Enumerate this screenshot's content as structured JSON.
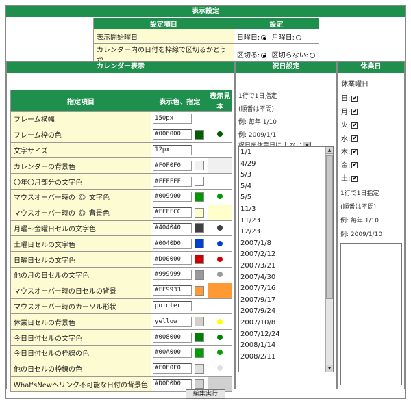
{
  "title": "表示設定",
  "top": {
    "col_item": "設定項目",
    "col_setting": "設定",
    "start_day_label": "表示開始曜日",
    "start_day_opt1": "日曜日:",
    "start_day_opt2": "月曜日:",
    "border_label": "カレンダー内の日付を枠線で区切るかどうか",
    "border_opt1": "区切る:",
    "border_opt2": "区切らない:"
  },
  "calendar": {
    "title": "カレンダー表示",
    "col_item": "指定項目",
    "col_value": "表示色、指定",
    "col_sample": "表示見本",
    "rows": [
      {
        "label": "フレーム横幅",
        "value": "150px",
        "swatch": "",
        "dot": ""
      },
      {
        "label": "フレーム枠の色",
        "value": "#006000",
        "swatch": "#006000",
        "dot": "#006000"
      },
      {
        "label": "文字サイズ",
        "value": "12px",
        "swatch": "",
        "dot": ""
      },
      {
        "label": "カレンダーの背景色",
        "value": "#F0F0F0",
        "swatch": "#F0F0F0",
        "dot": "",
        "sample_bg": "#F0F0F0"
      },
      {
        "label": "〇年〇月部分の文字色",
        "value": "#FFFFFF",
        "swatch": "#FFFFFF",
        "dot": ""
      },
      {
        "label": "マウスオーバー時の《》文字色",
        "value": "#009900",
        "swatch": "#009900",
        "dot": "#009900"
      },
      {
        "label": "マウスオーバー時の《》背景色",
        "value": "#FFFFCC",
        "swatch": "#FFFFCC",
        "dot": "",
        "sample_bg": "#FFFFCC"
      },
      {
        "label": "月曜～金曜日セルの文字色",
        "value": "#404040",
        "swatch": "#404040",
        "dot": "#404040"
      },
      {
        "label": "土曜日セルの文字色",
        "value": "#0040D0",
        "swatch": "#0040D0",
        "dot": "#0040D0"
      },
      {
        "label": "日曜日セルの文字色",
        "value": "#D00000",
        "swatch": "#D00000",
        "dot": "#D00000"
      },
      {
        "label": "他の月の日セルの文字色",
        "value": "#999999",
        "swatch": "#999999",
        "dot": "#999999"
      },
      {
        "label": "マウスオーバー時の日セルの背景",
        "value": "#FF9933",
        "swatch": "#FF9933",
        "dot": "",
        "sample_bg": "#FF9933"
      },
      {
        "label": "マウスオーバー時のカーソル形状",
        "value": "pointer",
        "swatch": "",
        "dot": ""
      },
      {
        "label": "休業日セルの背景色",
        "value": "yellow",
        "swatch": "#D4D0C8",
        "dot": "#FFFF00"
      },
      {
        "label": "今日日付セルの文字色",
        "value": "#008000",
        "swatch": "#008000",
        "dot": "#008000"
      },
      {
        "label": "今日日付セルの枠線の色",
        "value": "#00A000",
        "swatch": "#00A000",
        "dot": "#00A000"
      },
      {
        "label": "他の日セルの枠線の色",
        "value": "#E0E0E0",
        "swatch": "#E0E0E0",
        "dot": "#E0E0E0"
      },
      {
        "label": "What'sNewへリンク不可能な日付の背景色",
        "value": "#D0D0D0",
        "swatch": "#D0D0D0",
        "dot": "",
        "sample_bg": "#D0D0D0"
      }
    ]
  },
  "holiday": {
    "title": "祝日設定",
    "note1": "1行で1日指定",
    "note2": "(順番は不問)",
    "example1": "例: 毎年  1/10",
    "example2": "例: 2009/1/1",
    "select_label": "祝日を休業日に",
    "select_value": "しない",
    "dates": [
      "1/1",
      "4/29",
      "5/3",
      "5/4",
      "5/5",
      "11/3",
      "11/23",
      "12/23",
      "2007/1/8",
      "2007/2/12",
      "2007/3/21",
      "2007/4/30",
      "2007/7/16",
      "2007/9/17",
      "2007/9/24",
      "2007/10/8",
      "2007/12/24",
      "2008/1/14",
      "2008/2/11"
    ]
  },
  "closed": {
    "title": "休業日",
    "weekday_label": "休業曜日",
    "days": [
      "日:",
      "月:",
      "火:",
      "水:",
      "木:",
      "金:",
      "土:"
    ],
    "note1": "1行で1日指定",
    "note2": "(順番は不問)",
    "example1": "例: 毎年  1/10",
    "example2": "例: 2009/1/10"
  },
  "run_button": "編集実行",
  "colors": {
    "header_green": "#1e8f4d",
    "label_yellow": "#fdfbd2"
  }
}
